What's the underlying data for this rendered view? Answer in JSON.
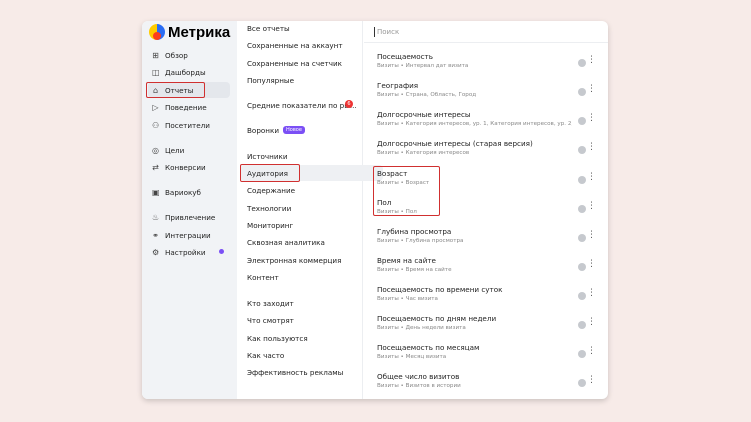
{
  "app": {
    "title": "Метрика"
  },
  "sidebar": {
    "items": [
      {
        "label": "Обзор",
        "icon": "grid-icon"
      },
      {
        "label": "Дашборды",
        "icon": "dashboard-icon"
      },
      {
        "label": "Отчеты",
        "icon": "reports-icon"
      },
      {
        "label": "Поведение",
        "icon": "play-icon"
      },
      {
        "label": "Посетители",
        "icon": "person-icon"
      },
      {
        "label": "Цели",
        "icon": "target-icon"
      },
      {
        "label": "Конверсии",
        "icon": "conversion-icon"
      },
      {
        "label": "Вариокуб",
        "icon": "cube-icon"
      },
      {
        "label": "Привлечение",
        "icon": "flame-icon"
      },
      {
        "label": "Интеграции",
        "icon": "link-icon"
      },
      {
        "label": "Настройки",
        "icon": "gear-icon"
      }
    ]
  },
  "reports_menu": {
    "items": [
      "Все отчеты",
      "Сохраненные на аккаунт",
      "Сохраненные на счетчик",
      "Популярные",
      "Средние показатели по ры...",
      "Воронки",
      "Источники",
      "Аудитория",
      "Содержание",
      "Технологии",
      "Мониторинг",
      "Сквозная аналитика",
      "Электронная коммерция",
      "Контент",
      "Кто заходит",
      "Что смотрят",
      "Как пользуются",
      "Как часто",
      "Эффективность рекламы"
    ],
    "badge_count": "6",
    "badge_new": "Новое"
  },
  "search": {
    "placeholder": "Поиск"
  },
  "reports": [
    {
      "title": "Посещаемость",
      "sub": "Визиты • Интервал дат визита"
    },
    {
      "title": "География",
      "sub": "Визиты • Страна, Область, Город"
    },
    {
      "title": "Долгосрочные интересы",
      "sub": "Визиты • Категория интересов, ур. 1, Категория интересов, ур. 2, Категория..."
    },
    {
      "title": "Долгосрочные интересы (старая версия)",
      "sub": "Визиты • Категория интересов"
    },
    {
      "title": "Возраст",
      "sub": "Визиты • Возраст"
    },
    {
      "title": "Пол",
      "sub": "Визиты • Пол"
    },
    {
      "title": "Глубина просмотра",
      "sub": "Визиты • Глубина просмотра"
    },
    {
      "title": "Время на сайте",
      "sub": "Визиты • Время на сайте"
    },
    {
      "title": "Посещаемость по времени суток",
      "sub": "Визиты • Час визита"
    },
    {
      "title": "Посещаемость по дням недели",
      "sub": "Визиты • День недели визита"
    },
    {
      "title": "Посещаемость по месяцам",
      "sub": "Визиты • Месяц визита"
    },
    {
      "title": "Общее число визитов",
      "sub": "Визиты • Визитов в истории"
    }
  ],
  "colors": {
    "highlight": "#d03030",
    "accent": "#7b4ff5"
  }
}
